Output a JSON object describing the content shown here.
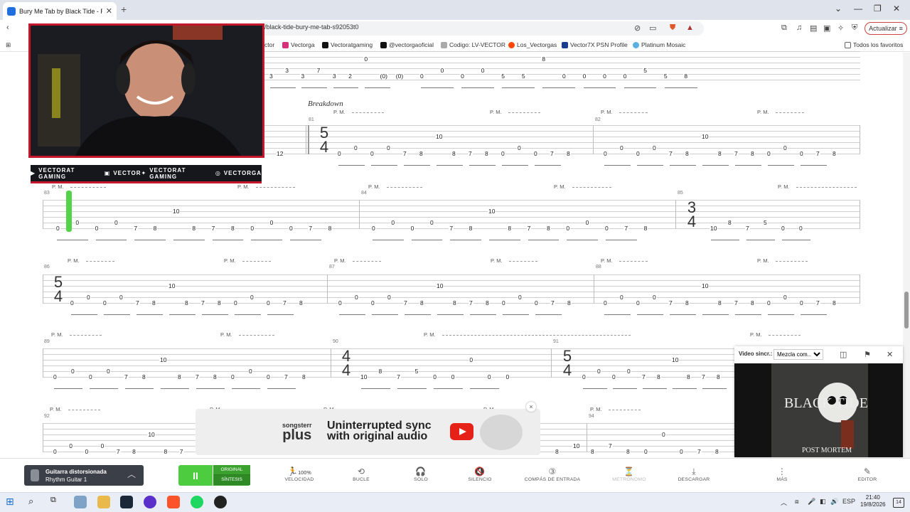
{
  "browser": {
    "tab_title": "Bury Me Tab by Black Tide - Ri",
    "url": "/black-tide-bury-me-tab-s92053t0",
    "update_label": "Actualizar",
    "bookmarks": [
      "ctor",
      "Vectorga",
      "Vectoratgaming",
      "@vectorgaoficial",
      "Codigo: LV-VECTOR",
      "Los_Vectorgas",
      "Vector7X PSN Profile",
      "Platinum Mosaic"
    ],
    "all_favorites": "Todos los favoritos"
  },
  "score": {
    "section_label": "Breakdown",
    "palm_mute": "P. M.",
    "measure_numbers": [
      "81",
      "82",
      "83",
      "84",
      "85",
      "86",
      "87",
      "88",
      "89",
      "90",
      "91",
      "92",
      "94"
    ],
    "time_signatures": {
      "five_four": [
        "5",
        "4"
      ],
      "three_four": [
        "3",
        "4"
      ],
      "four_four": [
        "4",
        "4"
      ]
    },
    "riff": [
      "0",
      "0",
      "0",
      "0",
      "7",
      "8",
      "10",
      "8",
      "7",
      "8",
      "0",
      "0",
      "0",
      "7",
      "8"
    ],
    "tail_riff": [
      "10",
      "8",
      "7",
      "5",
      "0",
      "0"
    ],
    "prev_fragment": [
      "12"
    ],
    "top_row": [
      "3",
      "3",
      "3",
      "7",
      "3",
      "2",
      "0",
      "(0)",
      "(0)",
      "0",
      "0",
      "0",
      "0",
      "5",
      "5",
      "8"
    ]
  },
  "webcam": {
    "social": [
      "VECTORAT GAMING",
      "VECTOR",
      "VECTORAT GAMING",
      "VECTORGA"
    ]
  },
  "ad": {
    "brand_top": "songsterr",
    "brand_bottom": "plus",
    "headline_1": "Uninterrupted sync",
    "headline_2": "with original audio",
    "close": "×"
  },
  "video_panel": {
    "label": "Video sincr.:",
    "selected": "Mezcla com...",
    "album_text": "BLACK TIDE",
    "album_sub": "POST MORTEM"
  },
  "player": {
    "track_name": "Guitarra distorsionada",
    "track_sub": "Rhythm Guitar 1",
    "play_icon": "II",
    "mode_original": "ORIGINAL",
    "mode_synth": "SÍNTESIS",
    "speed_value": "100%",
    "controls": [
      "VELOCIDAD",
      "BUCLE",
      "SOLO",
      "SILENCIO",
      "COMPÁS DE ENTRADA",
      "METRÓNOMO",
      "DESCARGAR",
      "MÁS",
      "EDITOR"
    ]
  },
  "taskbar": {
    "time": "21:40",
    "date": "19/8/2026",
    "lang": "ESP",
    "notif": "14"
  },
  "colors": {
    "accent_green": "#4ccc3e",
    "webcam_border": "#c4172c",
    "youtube_red": "#e62117"
  }
}
